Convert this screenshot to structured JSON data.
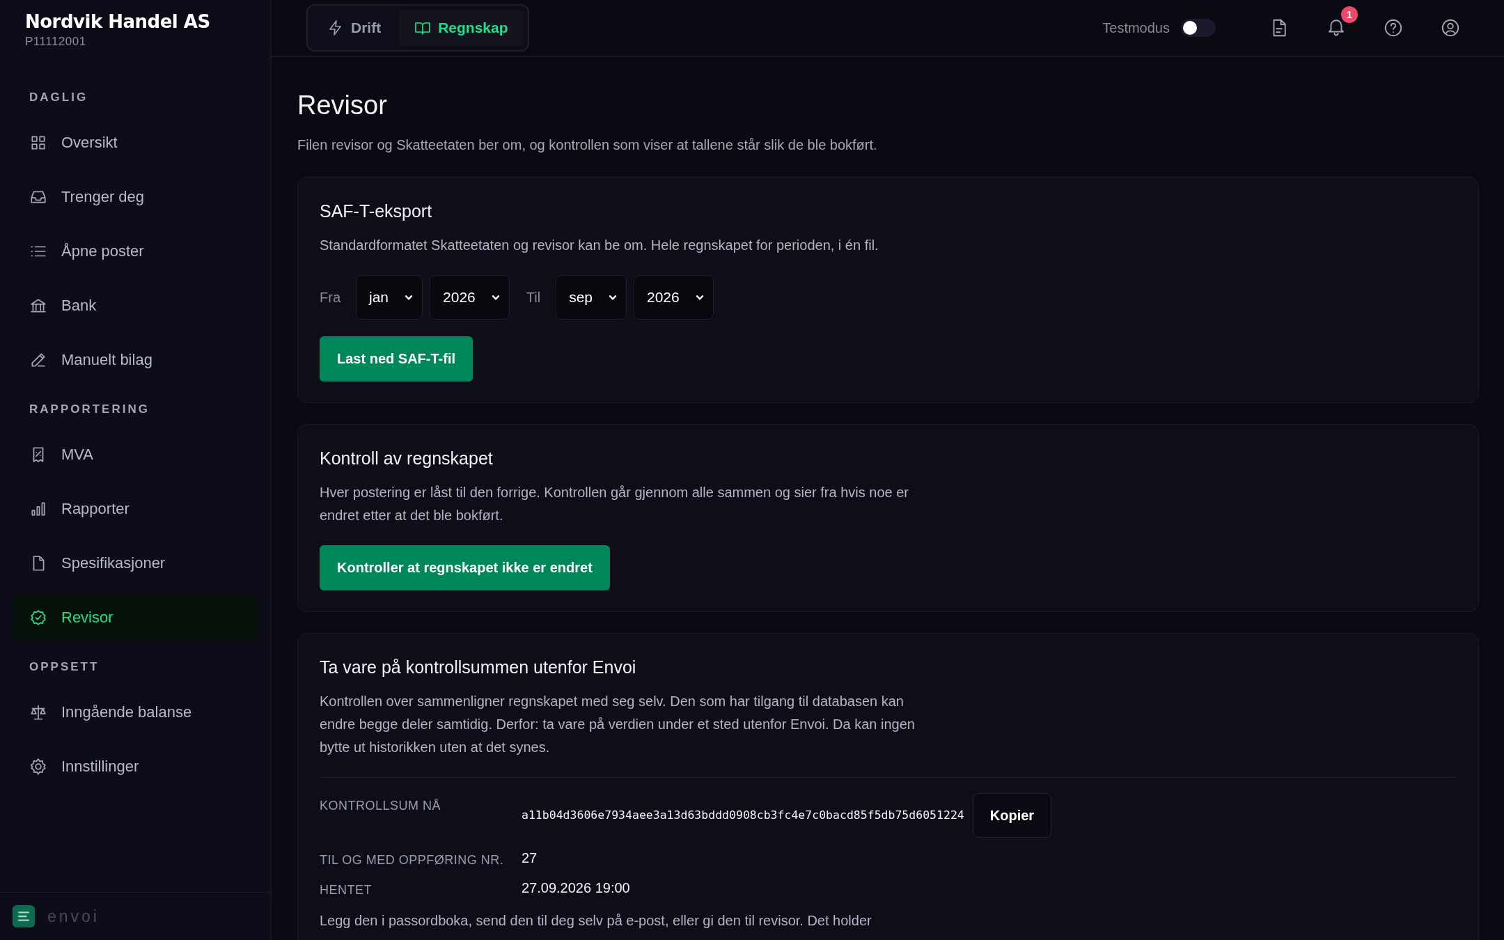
{
  "sidebar": {
    "company": "Nordvik Handel AS",
    "company_id": "P11112001",
    "sections": [
      {
        "heading": "DAGLIG",
        "items": [
          {
            "label": "Oversikt",
            "selected": false
          },
          {
            "label": "Trenger deg",
            "selected": false
          },
          {
            "label": "Åpne poster",
            "selected": false
          },
          {
            "label": "Bank",
            "selected": false
          },
          {
            "label": "Manuelt bilag",
            "selected": false
          }
        ]
      },
      {
        "heading": "RAPPORTERING",
        "items": [
          {
            "label": "MVA",
            "selected": false
          },
          {
            "label": "Rapporter",
            "selected": false
          },
          {
            "label": "Spesifikasjoner",
            "selected": false
          },
          {
            "label": "Revisor",
            "selected": true
          }
        ]
      },
      {
        "heading": "OPPSETT",
        "items": [
          {
            "label": "Inngående balanse",
            "selected": false
          },
          {
            "label": "Innstillinger",
            "selected": false
          }
        ]
      }
    ],
    "brand": "envoi"
  },
  "topbar": {
    "tabs": [
      {
        "label": "Drift",
        "selected": false
      },
      {
        "label": "Regnskap",
        "selected": true
      }
    ],
    "test_mode": {
      "label": "Testmodus",
      "on": false
    },
    "notification_count": "1"
  },
  "page": {
    "title": "Revisor",
    "subtitle": "Filen revisor og Skatteetaten ber om, og kontrollen som viser at tallene står slik de ble bokført."
  },
  "saft": {
    "title": "SAF-T-eksport",
    "description": "Standardformatet Skatteetaten og revisor kan be om. Hele regnskapet for perioden, i én fil.",
    "from_label": "Fra",
    "from_month": "jan",
    "from_year": "2026",
    "to_label": "Til",
    "to_month": "sep",
    "to_year": "2026",
    "button": "Last ned SAF-T-fil"
  },
  "control": {
    "title": "Kontroll av regnskapet",
    "description": "Hver postering er låst til den forrige. Kontrollen går gjennom alle sammen og sier fra hvis noe er endret etter at det ble bokført.",
    "button": "Kontroller at regnskapet ikke er endret"
  },
  "checksum": {
    "title": "Ta vare på kontrollsummen utenfor Envoi",
    "description": "Kontrollen over sammenligner regnskapet med seg selv. Den som har tilgang til databasen kan endre begge deler samtidig. Derfor: ta vare på verdien under et sted utenfor Envoi. Da kan ingen bytte ut historikken uten at det synes.",
    "fields": [
      {
        "kind": "hash",
        "label": "KONTROLLSUM NÅ",
        "value": "a11b04d3606e7934aee3a13d63bddd0908cb3fc4e7c0bacd85f5db75d6051224",
        "action": "Kopier"
      },
      {
        "kind": "text",
        "label": "TIL OG MED OPPFØRING NR.",
        "value": "27"
      },
      {
        "kind": "text",
        "label": "HENTET",
        "value": "27.09.2026 19:00"
      }
    ],
    "note": "Legg den i passordboka, send den til deg selv på e-post, eller gi den til revisor. Det holder"
  }
}
